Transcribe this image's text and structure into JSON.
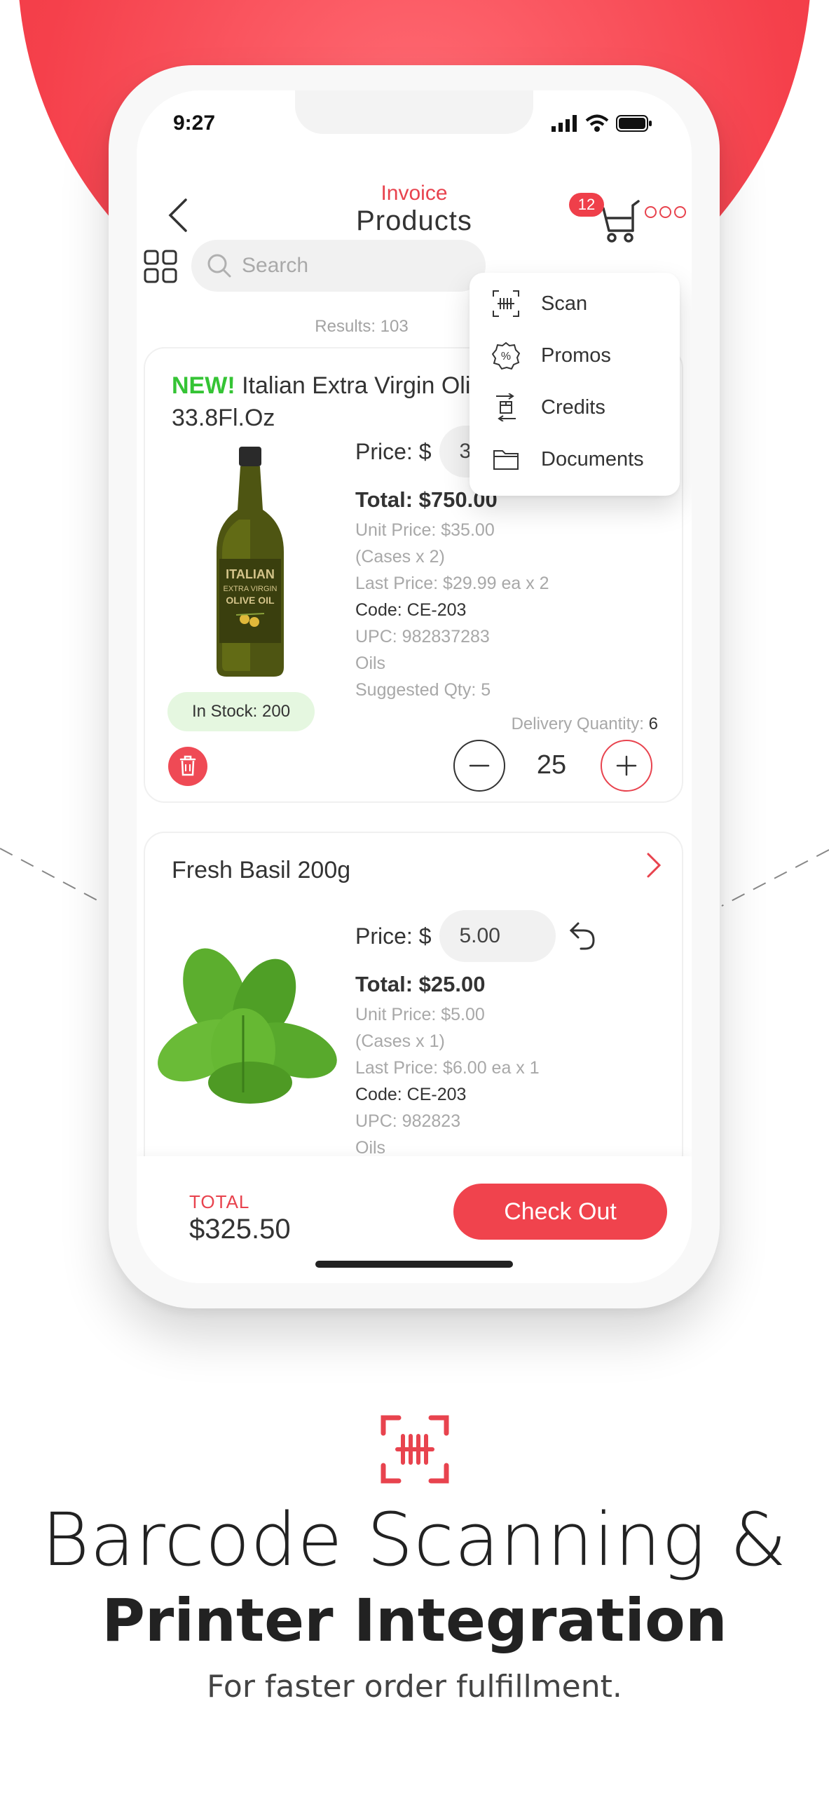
{
  "brand": {
    "accent": "#ef3f4a",
    "in_stock_bg": "#e5f7e0",
    "new_tag": "#35c435"
  },
  "status_bar": {
    "time": "9:27"
  },
  "header": {
    "subtitle": "Invoice",
    "title": "Products",
    "cart_count": "12"
  },
  "search": {
    "placeholder": "Search"
  },
  "results": "Results: 103",
  "menu": {
    "items": [
      {
        "label": "Scan",
        "icon": "barcode-scan-icon"
      },
      {
        "label": "Promos",
        "icon": "percent-badge-icon"
      },
      {
        "label": "Credits",
        "icon": "credit-exchange-icon"
      },
      {
        "label": "Documents",
        "icon": "folder-icon"
      }
    ]
  },
  "products": [
    {
      "new_tag": "NEW!",
      "name": "Italian Extra Virgin Olive Oil WT 33.8Fl.Oz",
      "price_label": "Price: $",
      "price": "30.00",
      "total": "Total: $750.00",
      "unit_price": "Unit Price: $35.00",
      "cases": "(Cases x 2)",
      "last_price": "Last Price: $29.99 ea x 2",
      "code": "Code: CE-203",
      "upc": "UPC: 982837283",
      "category": "Oils",
      "suggested": "Suggested Qty: 5",
      "in_stock": "In Stock: 200",
      "delivery_label": "Delivery Quantity:",
      "delivery_qty": "6",
      "quantity": "25",
      "bottle_text_1": "ITALIAN",
      "bottle_text_2": "EXTRA VIRGIN",
      "bottle_text_3": "OLIVE OIL"
    },
    {
      "name": "Fresh Basil 200g",
      "price_label": "Price: $",
      "price": "5.00",
      "total": "Total: $25.00",
      "unit_price": "Unit Price: $5.00",
      "cases": "(Cases x 1)",
      "last_price": "Last Price: $6.00 ea x 1",
      "code": "Code: CE-203",
      "upc": "UPC: 982823",
      "category": "Oils"
    }
  ],
  "footer": {
    "total_label": "TOTAL",
    "total_value": "$325.50",
    "checkout_label": "Check Out"
  },
  "marketing": {
    "headline_line1": "Barcode Scanning &",
    "headline_line2": "Printer Integration",
    "subline": "For faster order fulfillment."
  }
}
